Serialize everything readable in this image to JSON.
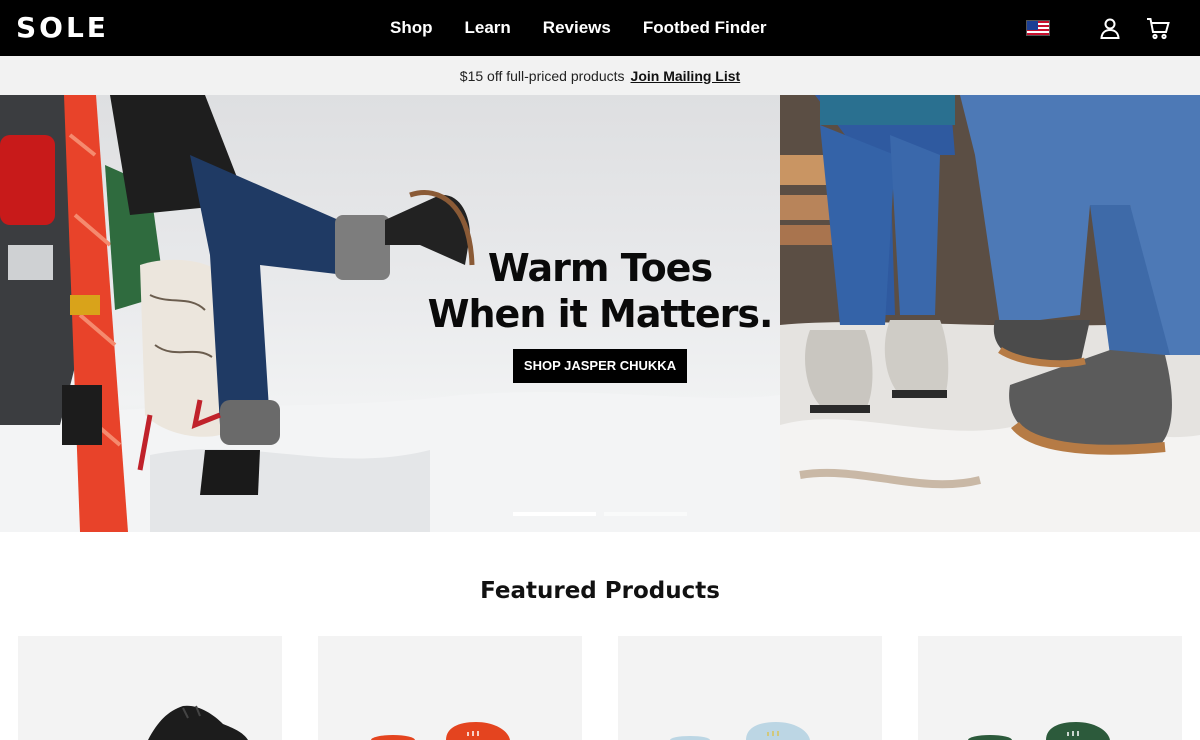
{
  "brand": {
    "logo_text": "SOLE"
  },
  "nav": {
    "links": [
      {
        "label": "Shop"
      },
      {
        "label": "Learn"
      },
      {
        "label": "Reviews"
      },
      {
        "label": "Footbed Finder"
      }
    ],
    "icons": [
      "us-flag-icon",
      "account-icon",
      "cart-icon"
    ]
  },
  "promo": {
    "text": "$15 off full-priced products",
    "link": "Join Mailing List"
  },
  "hero": {
    "headline_line1": "Warm Toes",
    "headline_line2": "When it Matters.",
    "cta": "SHOP JASPER CHUKKA",
    "slides_total": 2,
    "active_slide": 1
  },
  "featured": {
    "title": "Featured Products",
    "products": [
      {
        "image": "black-sneaker",
        "color": "#1c1c1c"
      },
      {
        "image": "orange-footbed",
        "color": "#e4441f"
      },
      {
        "image": "light-blue-footbed",
        "color": "#bcd6e4"
      },
      {
        "image": "green-footbed",
        "color": "#2c5a3b"
      }
    ]
  },
  "colors": {
    "nav_bg": "#000000",
    "promo_bg": "#f2f2f2",
    "cta_bg": "#000000"
  }
}
